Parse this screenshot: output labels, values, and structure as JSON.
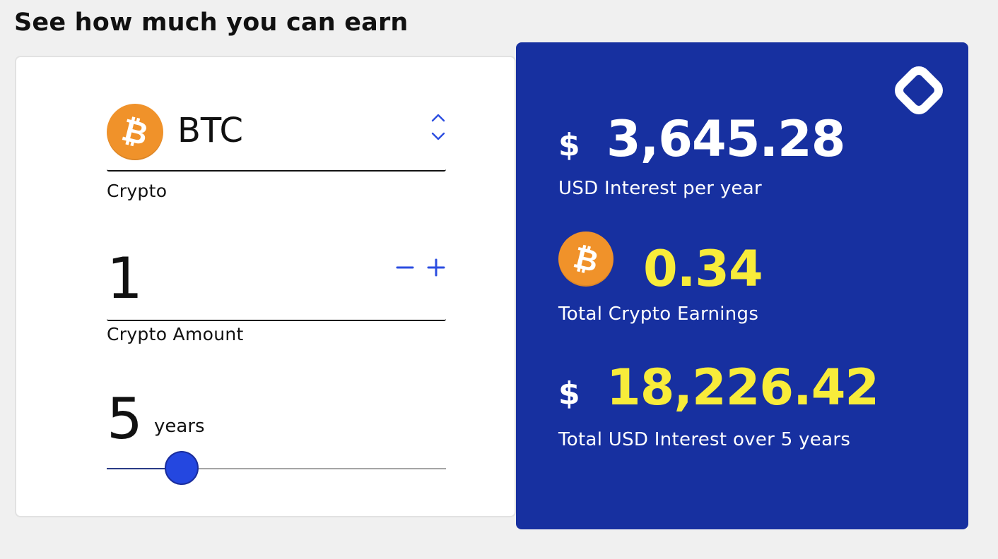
{
  "heading": "See how much you can earn",
  "calculator": {
    "crypto": {
      "symbol": "BTC",
      "coin_glyph": "₿",
      "label": "Crypto",
      "up_icon": "chevron-up-icon",
      "down_icon": "chevron-down-icon"
    },
    "amount": {
      "value": "1",
      "label": "Crypto Amount",
      "minus_icon": "minus-icon",
      "plus_icon": "plus-icon"
    },
    "term": {
      "value": "5",
      "unit": "years",
      "slider_fraction": 0.22
    }
  },
  "results": {
    "logo_icon": "rounded-diamond-logo-icon",
    "annual": {
      "currency": "$",
      "value": "3,645.28",
      "label": "USD Interest per year"
    },
    "crypto_earnings": {
      "coin_glyph": "₿",
      "value": "0.34",
      "label": "Total Crypto Earnings"
    },
    "total": {
      "currency": "$",
      "value": "18,226.42",
      "label": "Total USD Interest over 5 years"
    }
  },
  "colors": {
    "accent_blue": "#1730a0",
    "highlight_yellow": "#f8ec3a",
    "bitcoin_orange": "#f0922a",
    "slider_thumb": "#2447e0"
  }
}
